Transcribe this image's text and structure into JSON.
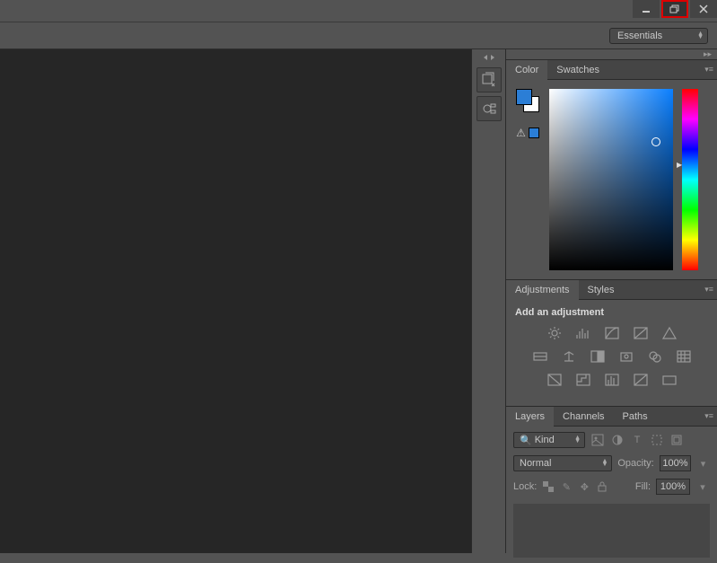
{
  "window": {
    "controls": {
      "minimize": "minimize",
      "restore": "restore",
      "close": "close"
    }
  },
  "workspace": {
    "selected": "Essentials"
  },
  "panels": {
    "color": {
      "tabs": [
        "Color",
        "Swatches"
      ],
      "active": 0,
      "foreground": "#2b7ed6",
      "background": "#ffffff"
    },
    "adjustments": {
      "tabs": [
        "Adjustments",
        "Styles"
      ],
      "active": 0,
      "heading": "Add an adjustment"
    },
    "layers": {
      "tabs": [
        "Layers",
        "Channels",
        "Paths"
      ],
      "active": 0,
      "filter_kind": "Kind",
      "blend_mode": "Normal",
      "opacity_label": "Opacity:",
      "opacity_value": "100%",
      "lock_label": "Lock:",
      "fill_label": "Fill:",
      "fill_value": "100%"
    }
  }
}
